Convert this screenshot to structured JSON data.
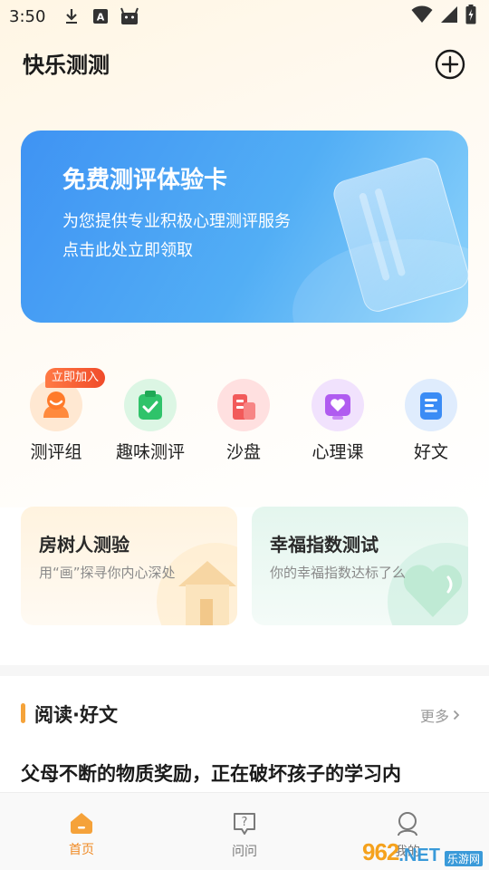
{
  "status_bar": {
    "time": "3:50",
    "icons": [
      "download-icon",
      "text-a-icon",
      "android-icon",
      "wifi-icon",
      "signal-icon",
      "battery-charging-icon"
    ]
  },
  "header": {
    "title": "快乐测测",
    "add_icon": "plus-circle-icon"
  },
  "banner": {
    "title": "免费测评体验卡",
    "line1": "为您提供专业积极心理测评服务",
    "line2": "点击此处立即领取"
  },
  "categories": [
    {
      "label": "测评组",
      "icon": "group-face-icon",
      "color": "#ff8a3d",
      "badge": "立即加入"
    },
    {
      "label": "趣味测评",
      "icon": "clipboard-check-icon",
      "color": "#2fc36a"
    },
    {
      "label": "沙盘",
      "icon": "buildings-icon",
      "color": "#f25a5a"
    },
    {
      "label": "心理课",
      "icon": "heart-screen-icon",
      "color": "#b05cf0"
    },
    {
      "label": "好文",
      "icon": "document-icon",
      "color": "#3b8cf5"
    }
  ],
  "test_cards": [
    {
      "title": "房树人测验",
      "subtitle": "用“画”探寻你内心深处"
    },
    {
      "title": "幸福指数测试",
      "subtitle": "你的幸福指数达标了么"
    }
  ],
  "reading": {
    "section_title": "阅读·好文",
    "more": "更多",
    "article_title": "父母不断的物质奖励，正在破坏孩子的学习内"
  },
  "bottom_nav": [
    {
      "label": "首页",
      "icon": "home-icon",
      "active": true
    },
    {
      "label": "问问",
      "icon": "question-bubble-icon",
      "active": false
    },
    {
      "label": "我的",
      "icon": "profile-icon",
      "active": false
    }
  ],
  "watermark": {
    "main": "962",
    "net": ".NET",
    "sub": "乐游网"
  }
}
